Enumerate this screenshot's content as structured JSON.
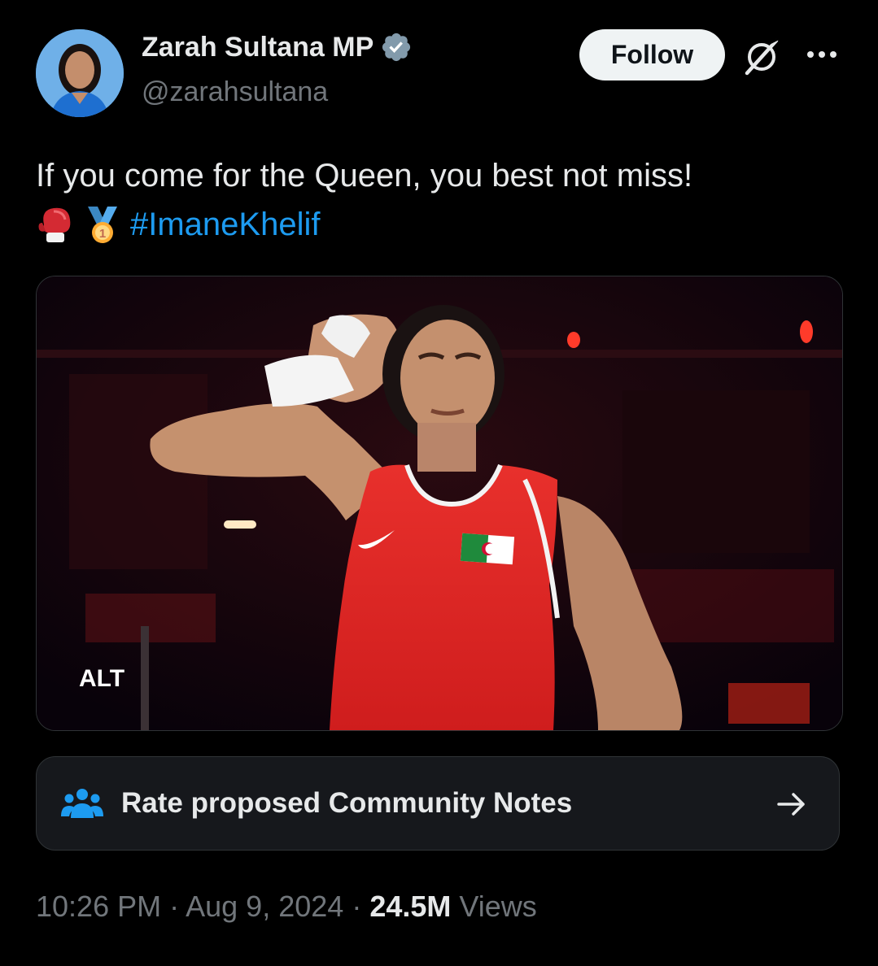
{
  "author": {
    "name": "Zarah Sultana MP",
    "handle": "@zarahsultana"
  },
  "header": {
    "follow_label": "Follow"
  },
  "tweet": {
    "text_line1": "If you come for the Queen, you best not miss!",
    "emojis": [
      "boxing-glove-icon",
      "gold-medal-icon"
    ],
    "hashtag": "#ImaneKhelif"
  },
  "media": {
    "alt_label": "ALT"
  },
  "community_notes": {
    "label": "Rate proposed Community Notes"
  },
  "meta": {
    "time": "10:26 PM",
    "separator": "·",
    "date": "Aug 9, 2024",
    "views_count": "24.5M",
    "views_label": "Views"
  },
  "colors": {
    "background": "#000000",
    "text": "#e7e9ea",
    "secondary": "#71767b",
    "link": "#1d9bf0",
    "follow_bg": "#eff3f4",
    "card_bg": "#16181c",
    "border": "#2f3336"
  }
}
